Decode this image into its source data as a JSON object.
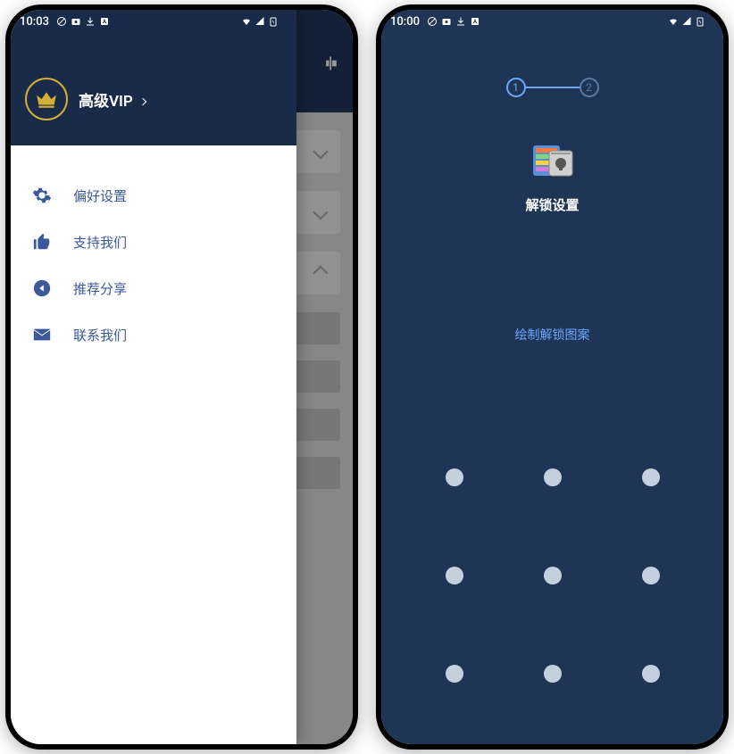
{
  "phone1": {
    "status": {
      "time": "10:03"
    },
    "drawer": {
      "title": "高级VIP",
      "items": [
        {
          "icon": "gear-icon",
          "label": "偏好设置"
        },
        {
          "icon": "thumbs-up-icon",
          "label": "支持我们"
        },
        {
          "icon": "share-icon",
          "label": "推荐分享"
        },
        {
          "icon": "mail-icon",
          "label": "联系我们"
        }
      ]
    }
  },
  "phone2": {
    "status": {
      "time": "10:00"
    },
    "stepper": {
      "current": "1",
      "next": "2"
    },
    "title": "解锁设置",
    "hint": "绘制解锁图案"
  },
  "colors": {
    "primary_dark": "#1a2b4a",
    "accent_blue": "#3b5998",
    "link_blue": "#6aa8ff",
    "gold": "#d4af37"
  }
}
